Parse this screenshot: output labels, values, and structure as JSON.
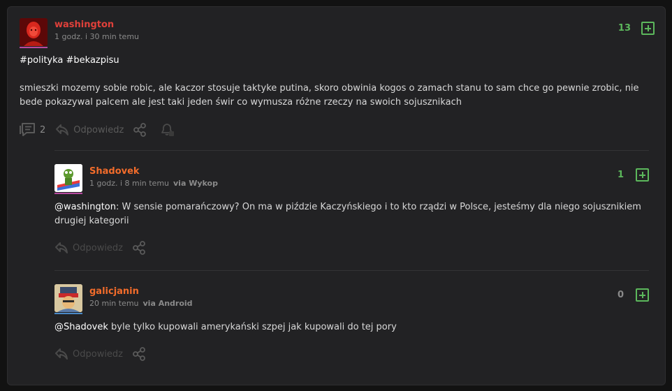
{
  "post": {
    "author": "washington",
    "author_color": "#e0403a",
    "time": "1 godz. i 30 min temu",
    "votes": "13",
    "vote_color": "#5cb85c",
    "tags": "#polityka #bekazpisu",
    "content": "smieszki mozemy sobie robic, ale kaczor stosuje taktyke putina, skoro obwinia kogos o zamach stanu to sam chce go pewnie zrobic, nie bede pokazywal palcem ale jest taki jeden świr co wymusza różne rzeczy na swoich sojusznikach",
    "comments_count": "2",
    "reply_label": "Odpowiedz",
    "icons": [
      "comments-icon",
      "reply-icon",
      "share-icon",
      "bell-icon"
    ]
  },
  "comments": [
    {
      "author": "Shadovek",
      "author_color": "#f26c2b",
      "time": "1 godz. i 8 min temu",
      "via": "via Wykop",
      "votes": "1",
      "vote_color": "#5cb85c",
      "mention": "@washington",
      "content": ": W sensie pomarańczowy? On ma w piździe Kaczyńskiego i to kto rządzi w Polsce, jesteśmy dla niego sojusznikiem drugiej kategorii",
      "reply_label": "Odpowiedz"
    },
    {
      "author": "galicjanin",
      "author_color": "#f26c2b",
      "time": "20 min temu",
      "via": "via Android",
      "votes": "0",
      "vote_color": "#8a8a8a",
      "mention": "@Shadovek",
      "content": " byle tylko kupowali amerykański szpej jak kupowali do tej pory",
      "reply_label": "Odpowiedz"
    }
  ]
}
